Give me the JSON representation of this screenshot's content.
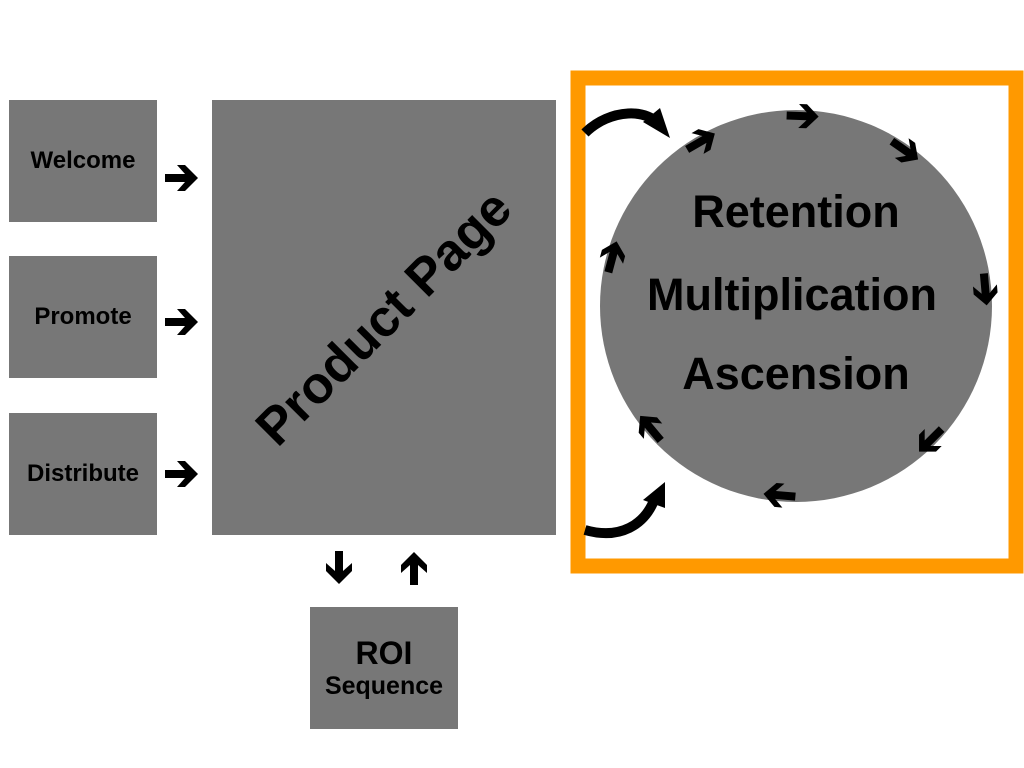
{
  "colors": {
    "box_fill": "#777777",
    "frame": "#ff9900",
    "text": "#000000",
    "arrow": "#000000"
  },
  "inputs": [
    {
      "label": "Welcome"
    },
    {
      "label": "Promote"
    },
    {
      "label": "Distribute"
    }
  ],
  "product_page": {
    "label": "Product Page"
  },
  "roi": {
    "title": "ROI",
    "subtitle": "Sequence"
  },
  "cycle": {
    "stages": [
      "Retention",
      "Multiplication",
      "Ascension"
    ],
    "direction": "clockwise"
  },
  "icons": {
    "input_arrow": "arrow-right-icon",
    "roi_down": "arrow-down-icon",
    "roi_up": "arrow-up-icon",
    "cycle_arrow": "cycle-arrow-icon",
    "curved_in": "curved-arrow-icon"
  }
}
